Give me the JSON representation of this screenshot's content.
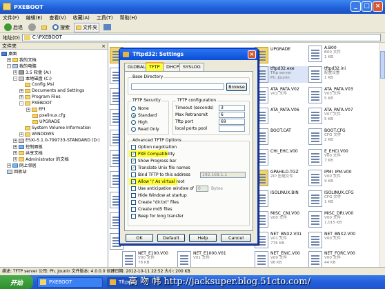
{
  "window": {
    "title": "PXEBOOT",
    "btn_min": "_",
    "btn_max": "□",
    "btn_close": "×"
  },
  "menu": [
    "文件(F)",
    "编辑(E)",
    "查看(V)",
    "收藏(A)",
    "工具(T)",
    "帮助(H)"
  ],
  "toolbar": {
    "back": "后退",
    "search": "搜索",
    "folders": "文件夹"
  },
  "address": {
    "label": "地址(D)",
    "path": "C:\\PXEBOOT"
  },
  "leftpane": {
    "header": "文件夹",
    "close": "×",
    "tree": [
      "桌面",
      "我的文档",
      "我的电脑",
      "3.5 软盘 (A:)",
      "本地磁盘 (C:)",
      "Config.Msi",
      "Documents and Settings",
      "Program Files",
      "PXEBOOT",
      "EFI",
      "pxelinux.cfg",
      "UPGRADE",
      "System Volume Information",
      "WINDOWS",
      "ESXI-5.1.0-799733-STANDARD (D:)",
      "控制面板",
      "共享文档",
      "Administrator 的文档",
      "网上邻居",
      "回收站"
    ]
  },
  "files": [
    {
      "name": "",
      "type": "",
      "size": ""
    },
    {
      "name": "UPGRADE",
      "type": "",
      "size": ""
    },
    {
      "name": "A.B00",
      "type": "B00 文件",
      "size": "1 KB"
    },
    {
      "name": "",
      "type": "",
      "size": ""
    },
    {
      "name": "tftpd32.exe",
      "type": "Tftp server",
      "size": "Ph. Jounin"
    },
    {
      "name": "tftpd32.ini",
      "type": "配置设置",
      "size": "1 KB"
    },
    {
      "name": "",
      "type": "",
      "size": ""
    },
    {
      "name": "ATA_PATA.V02",
      "type": "V02 文件",
      "size": "",
      "suffix": "V02"
    },
    {
      "name": "ATA_PATA.V03",
      "type": "V03 文件",
      "size": "5 KB"
    },
    {
      "name": "",
      "type": "",
      "size": ""
    },
    {
      "name": "ATA_PATA.V06",
      "type": "",
      "size": ""
    },
    {
      "name": "ATA_PATA.V07",
      "type": "V07 文件",
      "size": "5 KB"
    },
    {
      "name": "",
      "type": "",
      "size": ""
    },
    {
      "name": "BOOT.CAT",
      "type": "",
      "size": ""
    },
    {
      "name": "BOOT.CFG",
      "type": "CFG 文件",
      "size": "2 KB"
    },
    {
      "name": "",
      "type": "",
      "size": ""
    },
    {
      "name": "CHI_EHC.V00",
      "type": "",
      "size": ""
    },
    {
      "name": "E_EHCI.V00",
      "type": "V00 文件",
      "size": "7 KB"
    },
    {
      "name": "",
      "type": "",
      "size": ""
    },
    {
      "name": "GPAHILD.TGZ",
      "type": "ZIP 压缩文件",
      "size": ""
    },
    {
      "name": "IPMI_IPM.V00",
      "type": "V00 文件",
      "size": "9 KB"
    },
    {
      "name": "",
      "type": "",
      "size": ""
    },
    {
      "name": "ISOLINUX.BIN",
      "type": "",
      "size": ""
    },
    {
      "name": "ISOLINUX.CFG",
      "type": "CFG 文件",
      "size": "1 KB"
    },
    {
      "name": "",
      "type": "",
      "size": ""
    },
    {
      "name": "MISC_CNI.V00",
      "type": "V00 文件",
      "size": ""
    },
    {
      "name": "MISC_DRI.V00",
      "type": "V00 文件",
      "size": "1,015 KB"
    },
    {
      "name": "",
      "type": "",
      "size": ""
    },
    {
      "name": "NET_BNX2.V01",
      "type": "V01 文件",
      "size": "776 KB"
    },
    {
      "name": "NET_BNX2.V00",
      "type": "V00 文件",
      "size": "",
      "suffix": ""
    },
    {
      "name": "NET_E100.V00",
      "type": "V00 文件",
      "size": "78 KB"
    },
    {
      "name": "NET_E1000.V01",
      "type": "V01 文件",
      "size": ""
    },
    {
      "name": "NET_ENIC.V00",
      "type": "V00 文件",
      "size": "98 KB"
    },
    {
      "name": "NET_FORC.V00",
      "type": "V00 文件",
      "size": "44 KB"
    }
  ],
  "dialog": {
    "title": "Tftpd32: Settings",
    "close": "×",
    "tabs": [
      "GLOBAL",
      "TFTP",
      "DHCP",
      "SYSLOG"
    ],
    "base_dir_label": "Base Directory",
    "browse": "Browse",
    "security": {
      "label": "TFTP Security",
      "options": [
        "None",
        "Standard",
        "High",
        "Read Only"
      ]
    },
    "config": {
      "label": "TFTP configuration",
      "rows": [
        {
          "k": "Timeout (seconds)",
          "v": "3"
        },
        {
          "k": "Max Retransmit",
          "v": "6"
        },
        {
          "k": "Tftp port",
          "v": "69"
        },
        {
          "k": "local ports pool",
          "v": ""
        }
      ]
    },
    "advanced": {
      "label": "Advanced TFTP Options",
      "options": [
        {
          "label": "Option negotiation",
          "checked": false
        },
        {
          "label": "PXE Compatibility",
          "checked": true
        },
        {
          "label": "Show Progress bar",
          "checked": true
        },
        {
          "label": "Translate Unix file names",
          "checked": true
        },
        {
          "label": "Bind TFTP to this address",
          "checked": false
        },
        {
          "label": "Allow '\\' As virtual root",
          "checked": true
        },
        {
          "label": "Use anticipation window of",
          "checked": false
        },
        {
          "label": "Hide Window at startup",
          "checked": false
        },
        {
          "label": "Create \"dir.txt\" files",
          "checked": false
        },
        {
          "label": "Create md5 files",
          "checked": false
        },
        {
          "label": "Beep for long transfer",
          "checked": false
        }
      ],
      "bind_ip": "192.168.1.1",
      "window_size": "0",
      "bytes": "Bytes"
    },
    "buttons": {
      "ok": "OK",
      "default": "Default",
      "help": "Help",
      "cancel": "Cancel"
    }
  },
  "status": {
    "text": "描述: TFTP server 公司: Ph. Jounin 文件版本: 4.0.0.0 创建日期: 2012-10-11 22:52 大小: 200 KB"
  },
  "taskbar": {
    "start": "开始",
    "tasks": [
      "PXEBOOT",
      "Tftpd32"
    ]
  },
  "watermark": "高 吻 帏 http://jacksuper.blog.51cto.com/"
}
